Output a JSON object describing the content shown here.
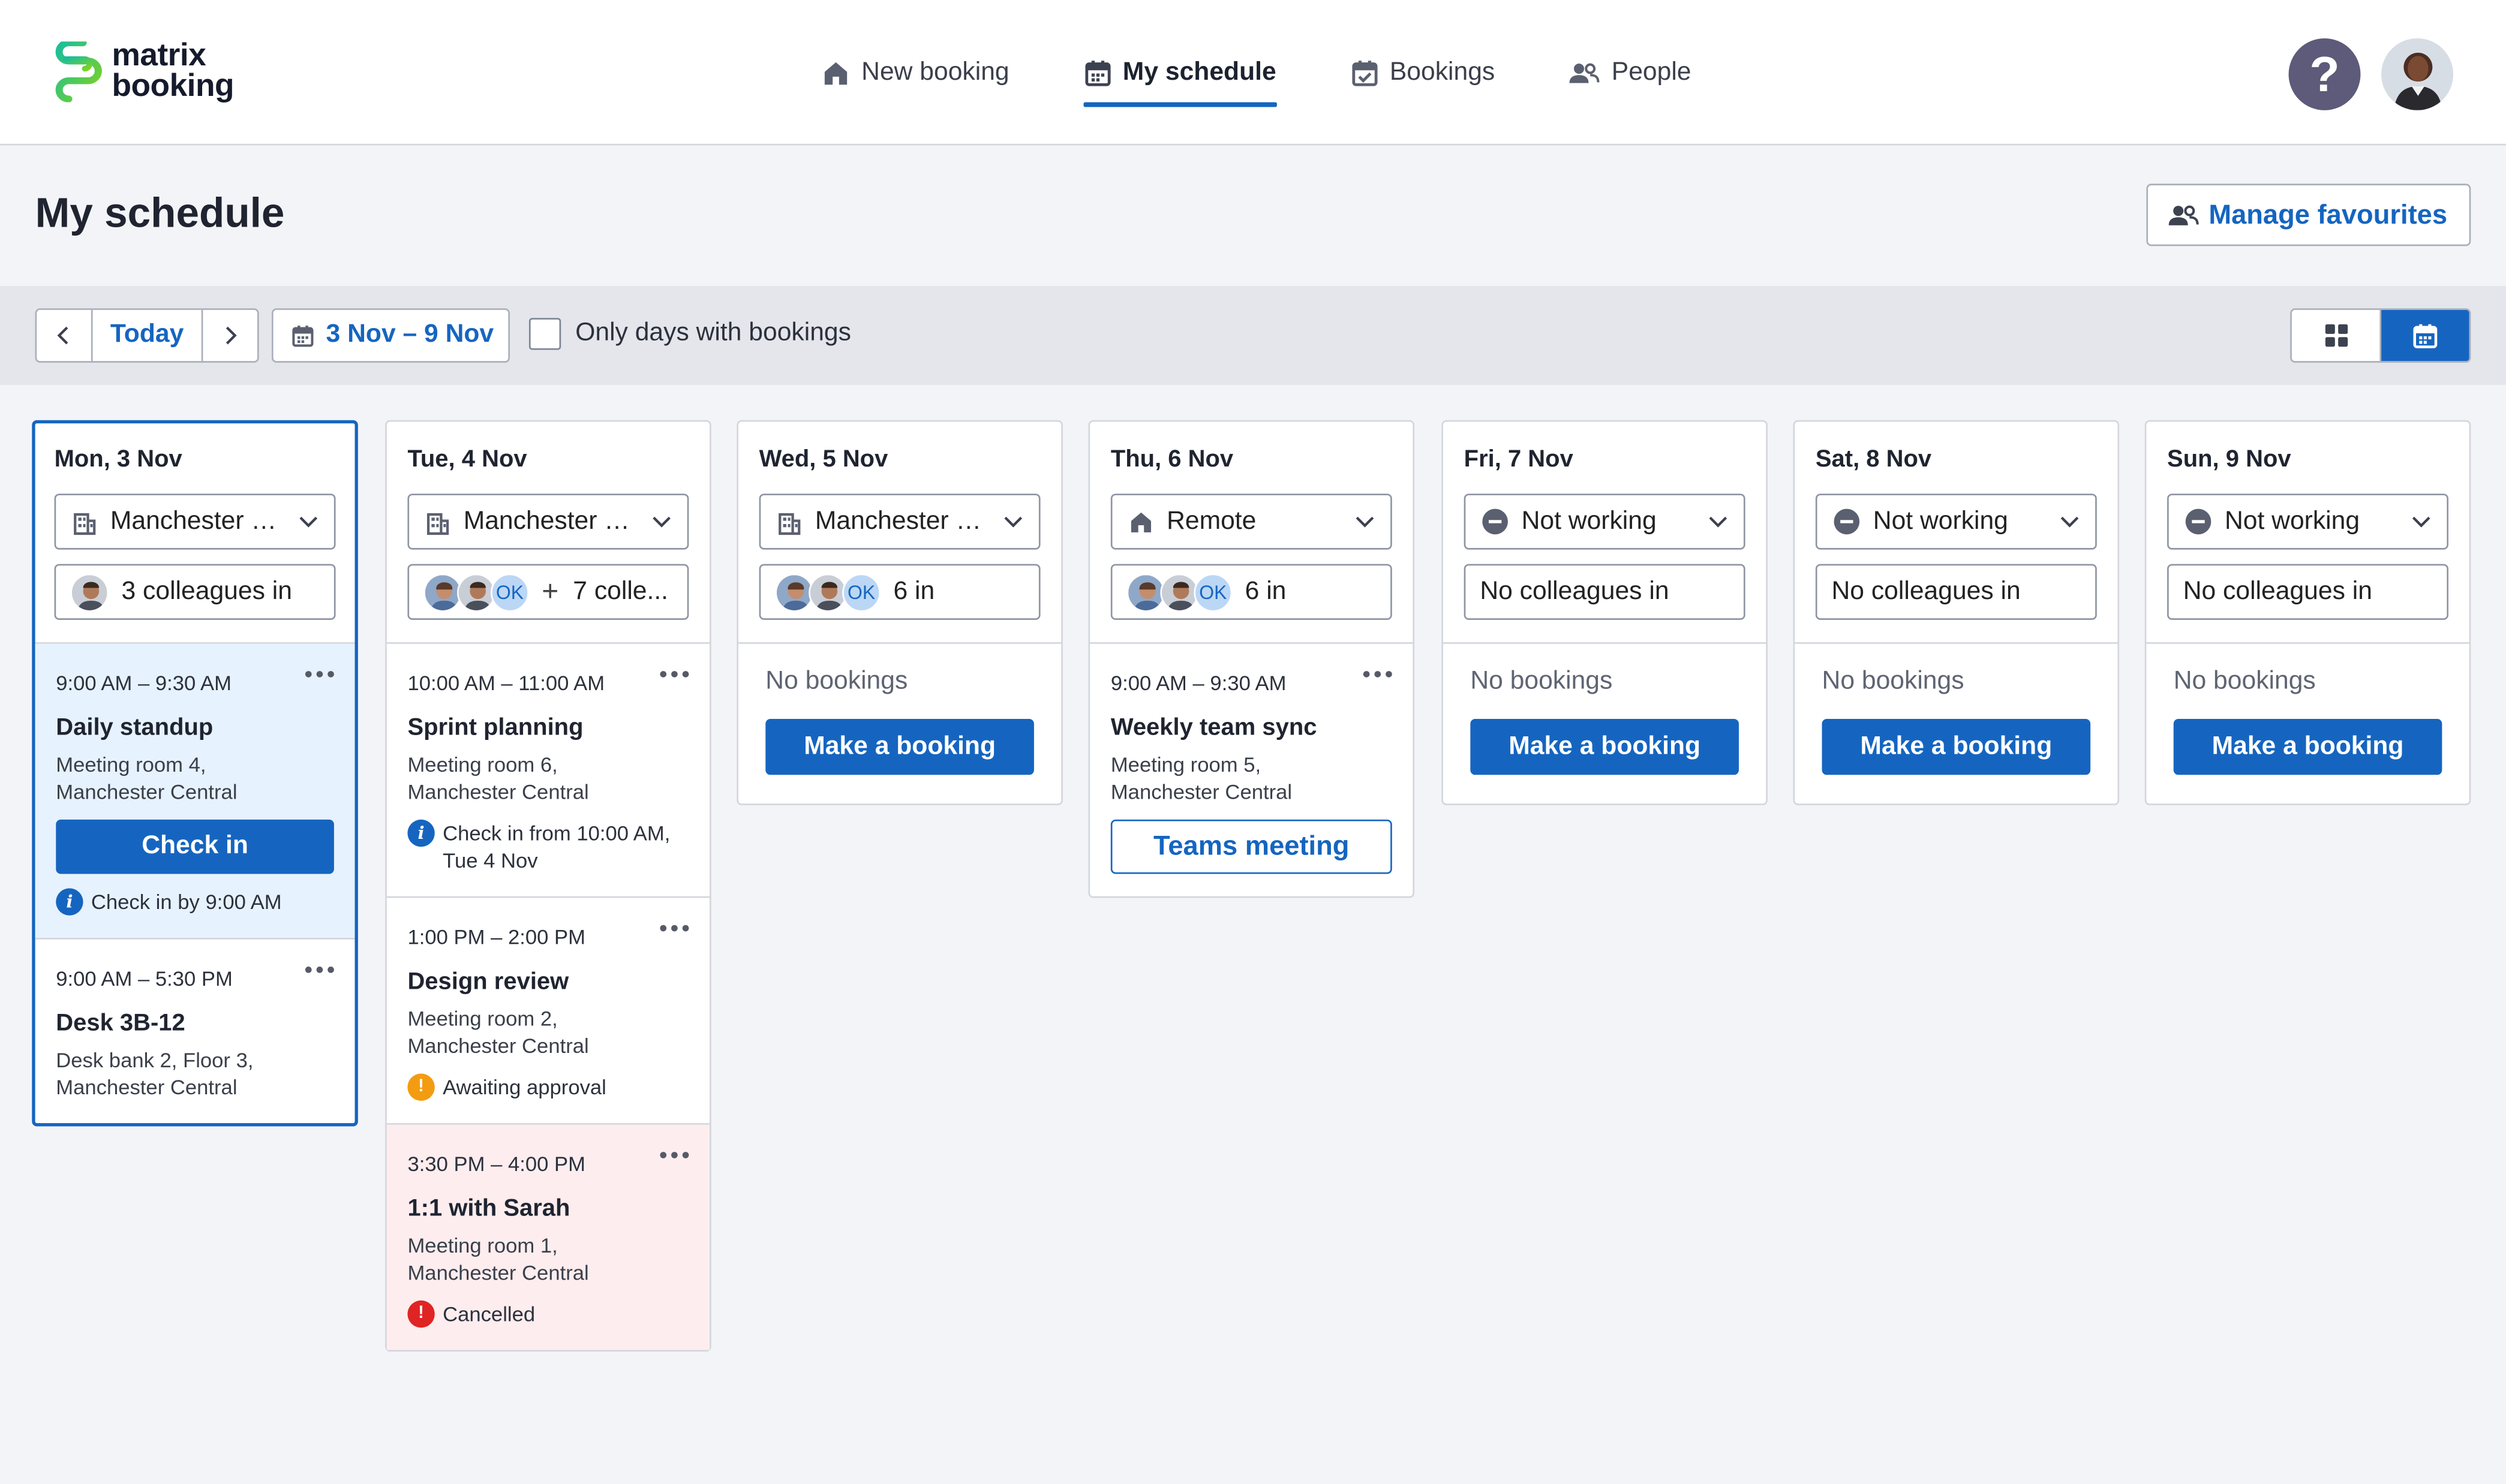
{
  "app": {
    "logo_line1": "matrix",
    "logo_line2": "booking",
    "brand_color": "#1565C0"
  },
  "nav": [
    {
      "label": "New booking",
      "icon": "home-icon",
      "active": false
    },
    {
      "label": "My schedule",
      "icon": "calendar-icon",
      "active": true
    },
    {
      "label": "Bookings",
      "icon": "calendar-check-icon",
      "active": false
    },
    {
      "label": "People",
      "icon": "people-icon",
      "active": false
    }
  ],
  "help_label": "?",
  "page": {
    "title": "My schedule",
    "manage_favourites": "Manage favourites"
  },
  "toolbar": {
    "today": "Today",
    "range": "3 Nov – 9 Nov",
    "only_days_label": "Only days with bookings",
    "only_days_checked": false,
    "view": "calendar"
  },
  "days": [
    {
      "title": "Mon, 3 Nov",
      "is_today": true,
      "location": "Manchester Ce...",
      "location_icon": "building-icon",
      "colleagues": "3 colleagues in",
      "bookings": [
        {
          "time": "9:00 AM – 9:30 AM",
          "title": "Daily standup",
          "loc1": "Meeting room 4,",
          "loc2": "Manchester Central",
          "action": "Check in",
          "note": "Check in by 9:00 AM",
          "note_type": "info",
          "state": "highlight"
        },
        {
          "time": "9:00 AM – 5:30 PM",
          "title": "Desk 3B-12",
          "loc1": "Desk bank 2, Floor 3,",
          "loc2": "Manchester Central"
        }
      ]
    },
    {
      "title": "Tue, 4 Nov",
      "location": "Manchester Ce...",
      "location_icon": "building-icon",
      "colleagues_ok": "OK",
      "colleagues": "7 colle...",
      "bookings": [
        {
          "time": "10:00 AM – 11:00 AM",
          "title": "Sprint planning",
          "loc1": "Meeting room 6,",
          "loc2": "Manchester Central",
          "note": "Check in from 10:00 AM, Tue 4 Nov",
          "note_type": "info"
        },
        {
          "time": "1:00 PM – 2:00 PM",
          "title": "Design review",
          "loc1": "Meeting room 2,",
          "loc2": "Manchester Central",
          "note": "Awaiting approval",
          "note_type": "warning"
        },
        {
          "time": "3:30 PM – 4:00 PM",
          "title": "1:1 with Sarah",
          "loc1": "Meeting room 1,",
          "loc2": "Manchester Central",
          "note": "Cancelled",
          "note_type": "error",
          "state": "cancelled"
        }
      ]
    },
    {
      "title": "Wed, 5 Nov",
      "location": "Manchester Ce...",
      "location_icon": "building-icon",
      "colleagues_ok": "OK",
      "colleagues": "6 in",
      "no_bookings": "No bookings",
      "make_booking": "Make a booking"
    },
    {
      "title": "Thu, 6 Nov",
      "location": "Remote",
      "location_icon": "home-icon",
      "colleagues_ok": "OK",
      "colleagues": "6 in",
      "bookings": [
        {
          "time": "9:00 AM – 9:30 AM",
          "title": "Weekly team sync",
          "loc1": "Meeting room 5,",
          "loc2": "Manchester Central",
          "action_outline": "Teams meeting"
        }
      ]
    },
    {
      "title": "Fri, 7 Nov",
      "location": "Not working",
      "location_icon": "minus-circle-icon",
      "colleagues": "No colleagues in",
      "no_bookings": "No bookings",
      "make_booking": "Make a booking"
    },
    {
      "title": "Sat, 8 Nov",
      "location": "Not working",
      "location_icon": "minus-circle-icon",
      "colleagues": "No colleagues in",
      "no_bookings": "No bookings",
      "make_booking": "Make a booking"
    },
    {
      "title": "Sun, 9 Nov",
      "location": "Not working",
      "location_icon": "minus-circle-icon",
      "colleagues": "No colleagues in",
      "no_bookings": "No bookings",
      "make_booking": "Make a booking"
    }
  ]
}
